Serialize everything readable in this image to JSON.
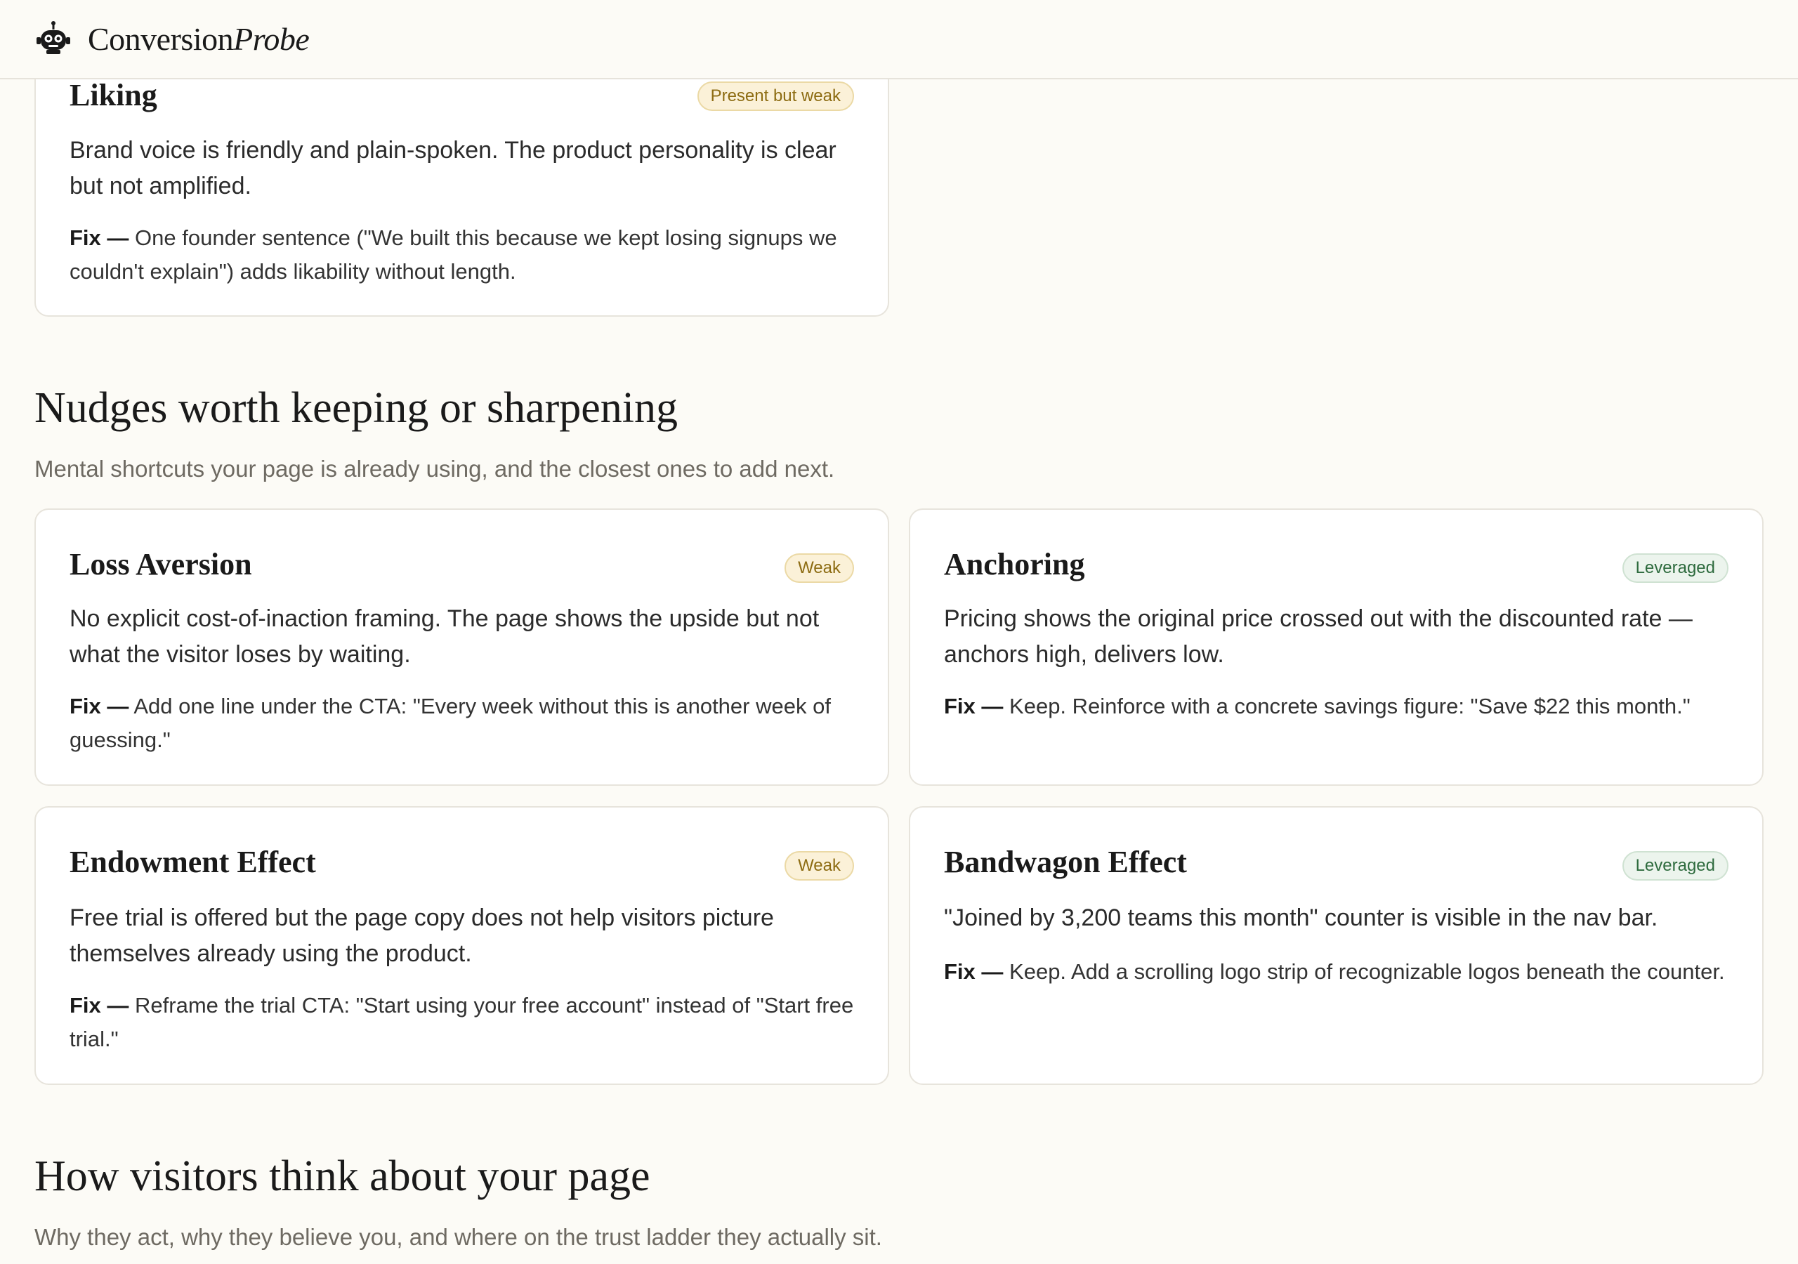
{
  "header": {
    "brand_main": "Conversion",
    "brand_accent": "Probe"
  },
  "liking_card": {
    "title": "Liking",
    "badge": "Present but weak",
    "body": "Brand voice is friendly and plain-spoken. The product personality is clear but not amplified.",
    "fix_label": "Fix —",
    "fix_text": "One founder sentence (\"We built this because we kept losing signups we couldn't explain\") adds likability without length."
  },
  "nudges_section": {
    "title": "Nudges worth keeping or sharpening",
    "subtitle": "Mental shortcuts your page is already using, and the closest ones to add next.",
    "cards": [
      {
        "title": "Loss Aversion",
        "badge": "Weak",
        "body": "No explicit cost-of-inaction framing. The page shows the upside but not what the visitor loses by waiting.",
        "fix_label": "Fix —",
        "fix_text": "Add one line under the CTA: \"Every week without this is another week of guessing.\""
      },
      {
        "title": "Anchoring",
        "badge": "Leveraged",
        "body": "Pricing shows the original price crossed out with the discounted rate — anchors high, delivers low.",
        "fix_label": "Fix —",
        "fix_text": "Keep. Reinforce with a concrete savings figure: \"Save $22 this month.\""
      },
      {
        "title": "Endowment Effect",
        "badge": "Weak",
        "body": "Free trial is offered but the page copy does not help visitors picture themselves already using the product.",
        "fix_label": "Fix —",
        "fix_text": "Reframe the trial CTA: \"Start using your free account\" instead of \"Start free trial.\""
      },
      {
        "title": "Bandwagon Effect",
        "badge": "Leveraged",
        "body": "\"Joined by 3,200 teams this month\" counter is visible in the nav bar.",
        "fix_label": "Fix —",
        "fix_text": "Keep. Add a scrolling logo strip of recognizable logos beneath the counter."
      }
    ]
  },
  "visitors_section": {
    "title": "How visitors think about your page",
    "subtitle": "Why they act, why they believe you, and where on the trust ladder they actually sit."
  },
  "colors": {
    "background": "#fcfbf6",
    "card": "#ffffff",
    "weak_badge": "#fbf1d8",
    "weak_text": "#8d6c12",
    "leveraged_badge": "#ecf4ed",
    "leveraged_text": "#2e6b3e"
  },
  "icons": {
    "logo": "robot-mascot-icon"
  }
}
